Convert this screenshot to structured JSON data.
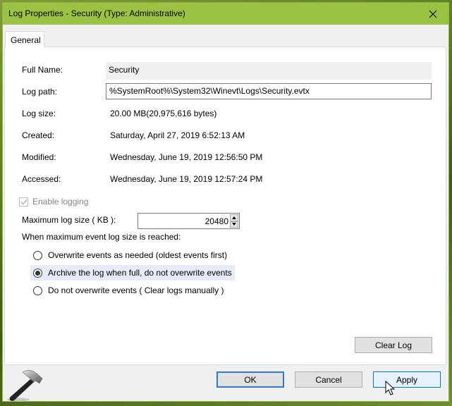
{
  "window": {
    "title": "Log Properties - Security (Type: Administrative)",
    "title_bar_color": "#9bc243"
  },
  "tabs": [
    {
      "label": "General",
      "active": true
    }
  ],
  "general": {
    "full_name": {
      "label": "Full Name:",
      "value": "Security"
    },
    "log_path": {
      "label": "Log path:",
      "value": "%SystemRoot%\\System32\\Winevt\\Logs\\Security.evtx"
    },
    "log_size": {
      "label": "Log size:",
      "value": "20.00 MB(20,975,616 bytes)"
    },
    "created": {
      "label": "Created:",
      "value": "Saturday, April 27, 2019 6:52:13 AM"
    },
    "modified": {
      "label": "Modified:",
      "value": "Wednesday, June 19, 2019 12:56:50 PM"
    },
    "accessed": {
      "label": "Accessed:",
      "value": "Wednesday, June 19, 2019 12:57:24 PM"
    },
    "enable_logging": {
      "label": "Enable logging",
      "checked": true,
      "disabled": true
    },
    "max_log_size": {
      "label": "Maximum log size ( KB ):",
      "value": "20480"
    },
    "when_reached_label": "When maximum event log size is reached:",
    "retention_options": [
      {
        "label": "Overwrite events as needed (oldest events first)",
        "selected": false
      },
      {
        "label": "Archive the log when full, do not overwrite events",
        "selected": true
      },
      {
        "label": "Do not overwrite events ( Clear logs manually )",
        "selected": false
      }
    ],
    "clear_log_label": "Clear Log"
  },
  "footer": {
    "ok_label": "OK",
    "cancel_label": "Cancel",
    "apply_label": "Apply"
  }
}
